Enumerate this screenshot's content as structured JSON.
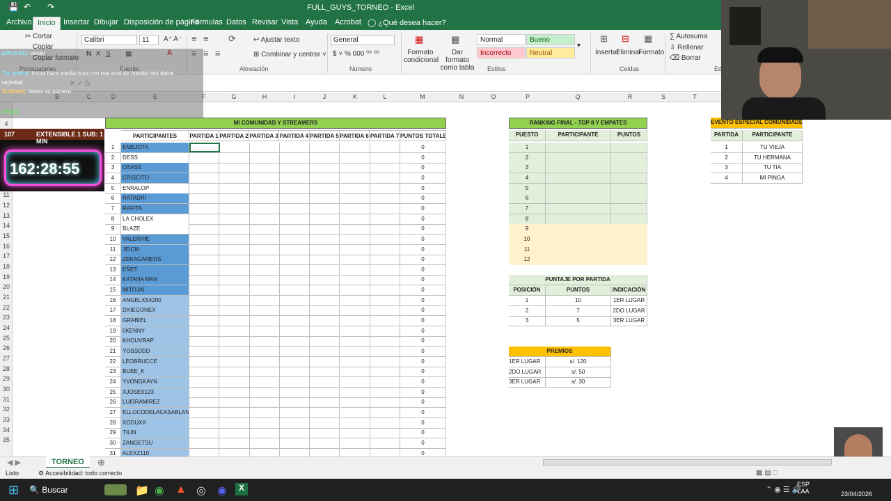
{
  "window": {
    "title": "FULL_GUYS_TORNEO - Excel"
  },
  "tabs": [
    "Archivo",
    "Inicio",
    "Insertar",
    "Dibujar",
    "Disposición de página",
    "Fórmulas",
    "Datos",
    "Revisar",
    "Vista",
    "Ayuda",
    "Acrobat",
    "¿Qué desea hacer?"
  ],
  "ribbon": {
    "cut": "Cortar",
    "copy": "Copiar",
    "copy_format": "Copiar formato",
    "font": "Calibri",
    "size": "11",
    "wrap": "Ajustar texto",
    "merge": "Combinar y centrar",
    "number_format": "General",
    "cond_format": "Formato condicional",
    "format_table": "Dar formato como tabla",
    "styles": {
      "normal": "Normal",
      "good": "Bueno",
      "bad": "Incorrecto",
      "neutral": "Neutral"
    },
    "insert": "Insertar",
    "delete": "Eliminar",
    "format": "Formato",
    "autosum": "Autosuma",
    "fill": "Rellenar",
    "clear": "Borrar",
    "groups": {
      "clipboard": "Portapapeles",
      "font": "Fuente",
      "alignment": "Alineación",
      "number": "Número",
      "styles": "Estilos",
      "cells": "Celdas",
      "editing": "Ed"
    }
  },
  "columns": [
    "B",
    "C",
    "D",
    "E",
    "F",
    "G",
    "H",
    "I",
    "J",
    "K",
    "L",
    "M",
    "N",
    "O",
    "P",
    "Q",
    "R",
    "S",
    "T"
  ],
  "rows": [
    "4",
    "5",
    "6",
    "7",
    "8",
    "9",
    "10",
    "11",
    "12",
    "13",
    "14",
    "15",
    "16",
    "17",
    "18",
    "19",
    "20",
    "21",
    "22",
    "23",
    "24",
    "25",
    "26",
    "27",
    "28",
    "29",
    "30",
    "31",
    "32",
    "33",
    "34",
    "35"
  ],
  "chat": [
    {
      "user": "jeffryn611",
      "text": "vavav"
    },
    {
      "user": "TvLumbre",
      "text": "Imura hace media hora con ese exel de mierda neri dame"
    },
    {
      "user": "",
      "text": "varjedad"
    },
    {
      "user": "Grabiee0",
      "text": "tienes su numero"
    },
    {
      "user": "xGigix",
      "text": ""
    }
  ],
  "timer": {
    "count": "107",
    "label": "EXTENSIBLE 1 SUB: 1 MIN",
    "time": "162:28:55"
  },
  "community": {
    "title": "MI COMUNIDAD Y STREAMERS",
    "headers": [
      "PARTICIPANTES",
      "PARTIDA 1",
      "PARTIDA 2",
      "PARTIDA 3",
      "PARTIDA 4",
      "PARTIDA 5",
      "PARTIDA 6",
      "PARTIDA 7",
      "PUNTOS TOTALES"
    ],
    "players": [
      {
        "n": "1",
        "name": "EMEJOTA",
        "tot": "0"
      },
      {
        "n": "2",
        "name": "DESS",
        "tot": "0"
      },
      {
        "n": "3",
        "name": "OSASS",
        "tot": "0"
      },
      {
        "n": "4",
        "name": "CRISCITO",
        "tot": "0"
      },
      {
        "n": "5",
        "name": "ENRALOP",
        "tot": "0"
      },
      {
        "n": "6",
        "name": "RATADRI",
        "tot": "0"
      },
      {
        "n": "7",
        "name": "RAFITA",
        "tot": "0"
      },
      {
        "n": "8",
        "name": "LA CHOLEX",
        "tot": "0"
      },
      {
        "n": "9",
        "name": "BLAZE",
        "tot": "0"
      },
      {
        "n": "10",
        "name": "VALERIHE",
        "tot": "0"
      },
      {
        "n": "11",
        "name": "JEICI8",
        "tot": "0"
      },
      {
        "n": "12",
        "name": "ZEKAGAMERS",
        "tot": "0"
      },
      {
        "n": "13",
        "name": "EÑET",
        "tot": "0"
      },
      {
        "n": "14",
        "name": "KATANA MAN",
        "tot": "0"
      },
      {
        "n": "15",
        "name": "MITOJAI",
        "tot": "0"
      },
      {
        "n": "16",
        "name": "ANGELXS4200",
        "tot": "0"
      },
      {
        "n": "17",
        "name": "DXIEGONEX",
        "tot": "0"
      },
      {
        "n": "18",
        "name": "GRABIEL",
        "tot": "0"
      },
      {
        "n": "19",
        "name": "0KENNY",
        "tot": "0"
      },
      {
        "n": "20",
        "name": "KHOUVRAP",
        "tot": "0"
      },
      {
        "n": "21",
        "name": "YOSSDDD",
        "tot": "0"
      },
      {
        "n": "22",
        "name": "LEOBRUCCE",
        "tot": "0"
      },
      {
        "n": "23",
        "name": "BUEE_K",
        "tot": "0"
      },
      {
        "n": "24",
        "name": "YVONGKAYN",
        "tot": "0"
      },
      {
        "n": "25",
        "name": "XJOSEX123",
        "tot": "0"
      },
      {
        "n": "26",
        "name": "LUISRAMIREZ",
        "tot": "0"
      },
      {
        "n": "27",
        "name": "ELLOCODELACASABLANCA",
        "tot": "0"
      },
      {
        "n": "28",
        "name": "XODUXX",
        "tot": "0"
      },
      {
        "n": "29",
        "name": "TILIN",
        "tot": "0"
      },
      {
        "n": "30",
        "name": "ZANGETSU",
        "tot": "0"
      },
      {
        "n": "31",
        "name": "ALEXZ110",
        "tot": "0"
      }
    ]
  },
  "ranking": {
    "title": "RANKING FINAL - TOP 8 Y EMPATES",
    "headers": [
      "PUESTO",
      "PARTICIPANTE",
      "PUNTOS"
    ],
    "positions": [
      "1",
      "2",
      "3",
      "4",
      "5",
      "6",
      "7",
      "8",
      "9",
      "10",
      "11",
      "12"
    ]
  },
  "scoring": {
    "title": "PUNTAJE POR PARTIDA",
    "headers": [
      "POSICIÓN",
      "PUNTOS",
      "INDICACIÓN"
    ],
    "rows": [
      [
        "1",
        "10",
        "1ER LUGAR"
      ],
      [
        "2",
        "7",
        "2DO LUGAR"
      ],
      [
        "3",
        "5",
        "3ER LUGAR"
      ]
    ]
  },
  "prizes": {
    "title": "PREMIOS",
    "rows": [
      [
        "1ER LUGAR",
        "s/. 120"
      ],
      [
        "2DO LUGAR",
        "s/. 50"
      ],
      [
        "3ER LUGAR",
        "s/. 30"
      ]
    ]
  },
  "event": {
    "title": "EVENTO ESPECIAL COMUNIDADES",
    "headers": [
      "PARTIDA",
      "PARTICIPANTE"
    ],
    "rows": [
      [
        "1",
        "TU VIEJA"
      ],
      [
        "2",
        "TU HERMANA"
      ],
      [
        "3",
        "TU TIA"
      ],
      [
        "4",
        "MI PINGA"
      ]
    ]
  },
  "sheet_tab": "TORNEO",
  "status": {
    "ready": "Listo",
    "accessibility": "Accesibilidad: todo correcto"
  },
  "taskbar": {
    "search": "Buscar",
    "lang1": "ESP",
    "lang2": "LAA",
    "date": "23/04/2026"
  },
  "badge": "x2",
  "colors": {
    "excel_green": "#217346",
    "header_green": "#92d050",
    "blue_dark": "#5b9bd5",
    "blue_light": "#9dc3e6",
    "rank_green": "#e2efda",
    "rank_cream": "#fff2cc",
    "gold": "#ffc000"
  }
}
